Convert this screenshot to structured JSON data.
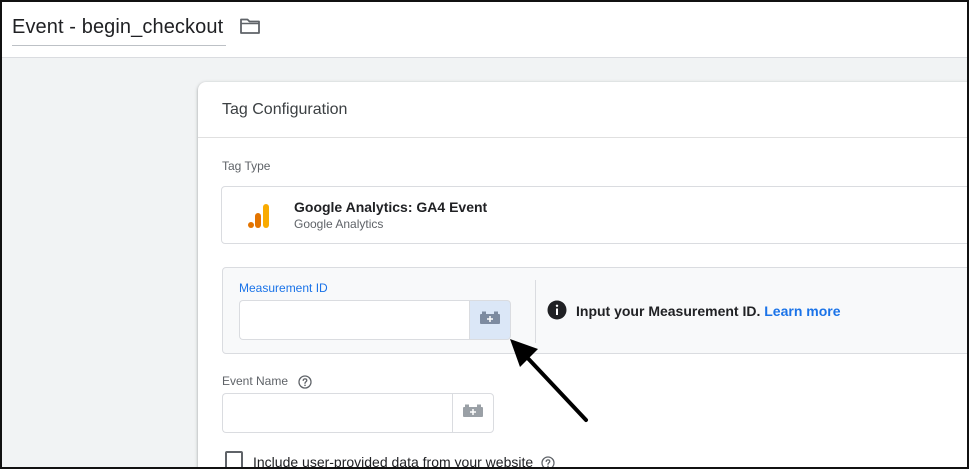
{
  "header": {
    "tag_name": "Event - begin_checkout",
    "folder_icon": "folder-icon"
  },
  "card": {
    "title": "Tag Configuration",
    "tag_type": {
      "label": "Tag Type",
      "name": "Google Analytics: GA4 Event",
      "provider": "Google Analytics",
      "icon": "google-analytics-icon",
      "icon_color": "#f9ab00"
    },
    "measurement": {
      "label": "Measurement ID",
      "value": "",
      "variable_icon": "variable-picker-icon",
      "info_icon": "info-icon",
      "info_text": "Input your Measurement ID.",
      "learn_more": "Learn more"
    },
    "event_name": {
      "label": "Event Name",
      "value": "",
      "help_icon": "help-icon",
      "variable_icon": "variable-picker-icon"
    },
    "user_data": {
      "label": "Include user-provided data from your website",
      "checked": false,
      "help_icon": "help-icon"
    }
  },
  "annotation": {
    "arrow_icon": "arrow-pointer-icon"
  },
  "colors": {
    "accent": "#1a73e8",
    "ga_orange": "#f9ab00",
    "ga_orange_dark": "#e37400",
    "button_highlight": "#dbe7f7"
  }
}
